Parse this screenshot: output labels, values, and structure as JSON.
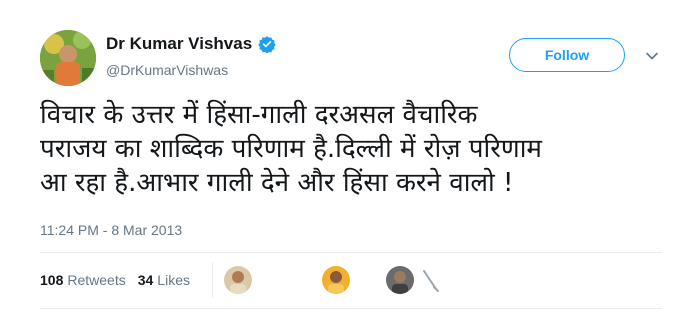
{
  "author": {
    "display_name": "Dr Kumar Vishvas",
    "handle": "@DrKumarVishwas",
    "verified": true
  },
  "follow_button": {
    "label": "Follow"
  },
  "tweet": {
    "text": "विचार के उत्तर में हिंसा-गाली दरअसल वैचारिक\nपराजय का शाब्दिक परिणाम है.दिल्ली में रोज़ परिणाम\nआ रहा है.आभार गाली देने और हिंसा करने वालो !",
    "timestamp": "11:24 PM - 8 Mar 2013"
  },
  "stats": {
    "retweets_count": "108",
    "retweets_label": "Retweets",
    "likes_count": "34",
    "likes_label": "Likes"
  },
  "icons": {
    "verified": "verified-badge-icon",
    "caret": "chevron-down-icon"
  },
  "colors": {
    "accent": "#1da1f2",
    "muted": "#657786",
    "text": "#14171a"
  }
}
